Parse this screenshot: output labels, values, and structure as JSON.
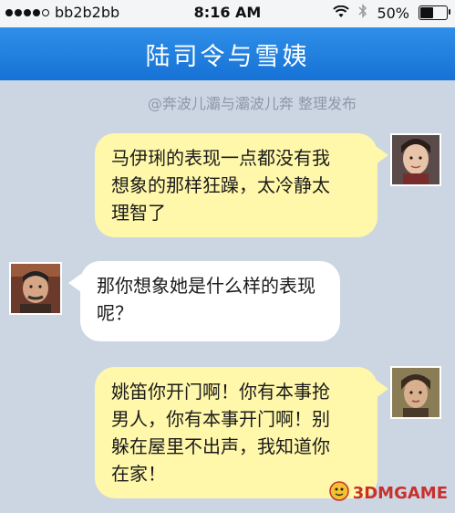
{
  "status_bar": {
    "carrier": "bb2b2bb",
    "time": "8:16 AM",
    "battery": "50%",
    "battery_level": 0.5
  },
  "header": {
    "title": "陆司令与雪姨"
  },
  "credit": "@奔波儿灞与灞波儿奔 整理发布",
  "messages": [
    {
      "side": "right",
      "speaker": "mayili",
      "lines": [
        "马伊琍的表现一点都没有我",
        "想象的那样狂躁，太冷静太",
        "理智了"
      ]
    },
    {
      "side": "left",
      "speaker": "commander-lu",
      "lines": [
        "那你想象她是什么样的表现",
        "呢？"
      ]
    },
    {
      "side": "right",
      "speaker": "xueyi",
      "lines": [
        "姚笛你开门啊！你有本事抢",
        "男人，你有本事开门啊！别",
        "躲在屋里不出声，我知道你",
        "在家！"
      ]
    }
  ],
  "watermark": {
    "text": "3DMGAME"
  },
  "colors": {
    "background": "#ccd6e3",
    "nav": "#1f7fe0",
    "bubble_right": "#fff7aa",
    "bubble_left": "#ffffff"
  }
}
